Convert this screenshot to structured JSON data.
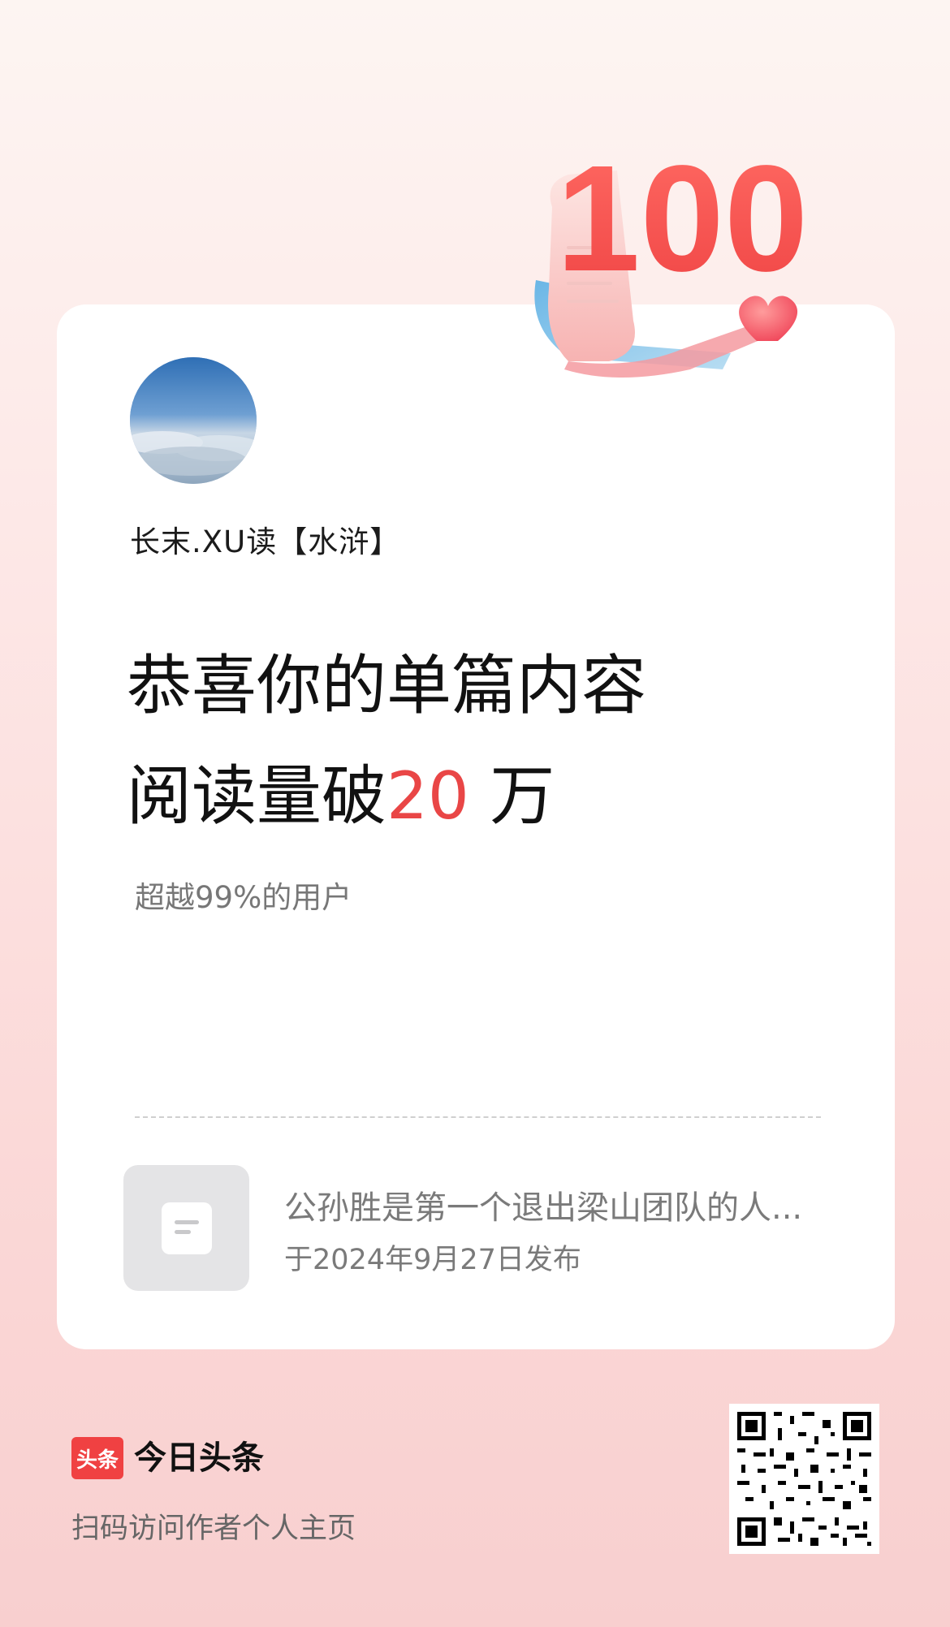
{
  "badge": {
    "number": "100"
  },
  "card": {
    "author_name": "长末.XU读【水浒】",
    "headline_line1": "恭喜你的单篇内容",
    "headline_line2_prefix": "阅读量破",
    "headline_line2_highlight": "20",
    "headline_line2_suffix": " 万",
    "subtitle": "超越99%的用户",
    "article_title": "公孙胜是第一个退出梁山团队的人...",
    "article_date": "于2024年9月27日发布"
  },
  "footer": {
    "logo_text": "头条",
    "brand_name": "今日头条",
    "caption": "扫码访问作者个人主页"
  },
  "colors": {
    "accent": "#e94646",
    "brand_red": "#f04142"
  },
  "icons": {
    "thumb": "document-icon",
    "badge_decoration": "heart-icon"
  }
}
